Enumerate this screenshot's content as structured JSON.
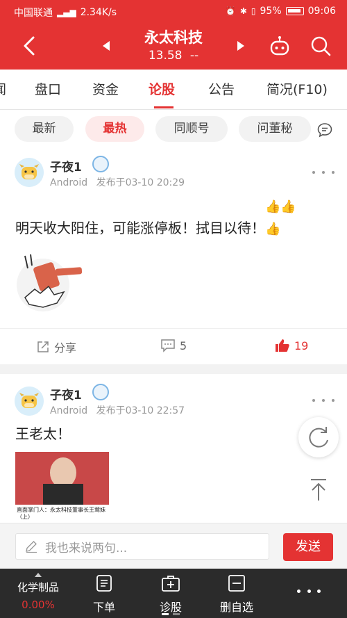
{
  "status_bar": {
    "carrier": "中国联通",
    "net_speed": "2.34K/s",
    "battery": "95%",
    "time": "09:06"
  },
  "header": {
    "stock_name": "永太科技",
    "price": "13.58",
    "change": "--"
  },
  "tabs": [
    "闻",
    "盘口",
    "资金",
    "论股",
    "公告",
    "简况(F10)"
  ],
  "active_tab": "论股",
  "filters": [
    "最新",
    "最热",
    "同顺号",
    "问董秘"
  ],
  "active_filter": "最热",
  "posts": [
    {
      "username": "子夜1",
      "device": "Android",
      "date": "发布于03-10 20:29",
      "text": "明天收大阳住，可能涨停板！拭目以待！",
      "share_label": "分享",
      "comments": "5",
      "likes": "19"
    },
    {
      "username": "子夜1",
      "device": "Android",
      "date": "发布于03-10 22:57",
      "text": "王老太！",
      "video_caption": "直面掌门人：永太科技董事长王莺妹（上）"
    }
  ],
  "comment_bar": {
    "placeholder": "我也来说两句...",
    "send_label": "发送"
  },
  "bottom_nav": {
    "stock_name": "化学制品",
    "stock_change": "0.00%",
    "items": [
      "下单",
      "诊股",
      "删自选"
    ]
  },
  "colors": {
    "accent": "#e43333",
    "nav_bg": "#2b2b2b"
  }
}
